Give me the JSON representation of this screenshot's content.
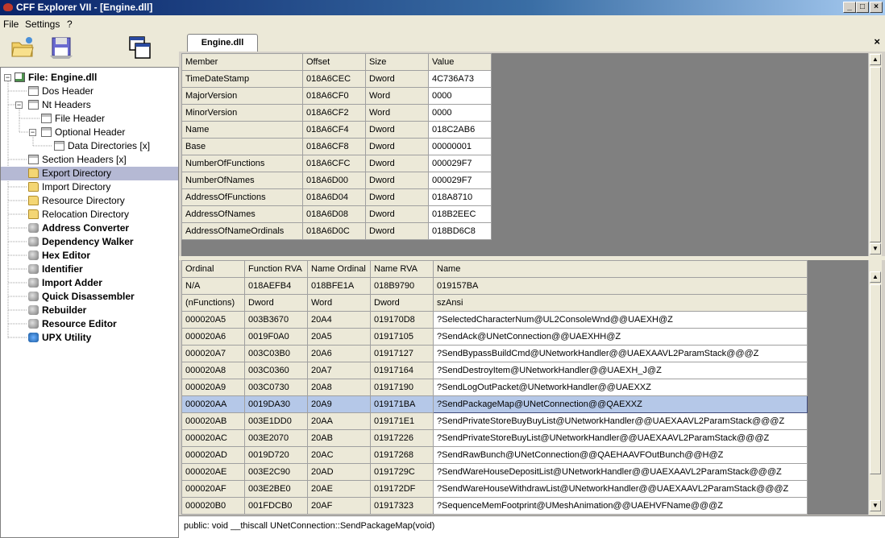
{
  "window": {
    "title": "CFF Explorer VII - [Engine.dll]",
    "minimize": "_",
    "maximize": "□",
    "close": "×"
  },
  "menu": [
    "File",
    "Settings",
    "?"
  ],
  "tree": {
    "root": "File: Engine.dll",
    "items": [
      "Dos Header",
      "Nt Headers",
      "File Header",
      "Optional Header",
      "Data Directories [x]",
      "Section Headers [x]",
      "Export Directory",
      "Import Directory",
      "Resource Directory",
      "Relocation Directory",
      "Address Converter",
      "Dependency Walker",
      "Hex Editor",
      "Identifier",
      "Import Adder",
      "Quick Disassembler",
      "Rebuilder",
      "Resource Editor",
      "UPX Utility"
    ]
  },
  "tab": {
    "label": "Engine.dll",
    "close": "×"
  },
  "export_table": {
    "headers": [
      "Member",
      "Offset",
      "Size",
      "Value"
    ],
    "rows": [
      [
        "TimeDateStamp",
        "018A6CEC",
        "Dword",
        "4C736A73"
      ],
      [
        "MajorVersion",
        "018A6CF0",
        "Word",
        "0000"
      ],
      [
        "MinorVersion",
        "018A6CF2",
        "Word",
        "0000"
      ],
      [
        "Name",
        "018A6CF4",
        "Dword",
        "018C2AB6"
      ],
      [
        "Base",
        "018A6CF8",
        "Dword",
        "00000001"
      ],
      [
        "NumberOfFunctions",
        "018A6CFC",
        "Dword",
        "000029F7"
      ],
      [
        "NumberOfNames",
        "018A6D00",
        "Dword",
        "000029F7"
      ],
      [
        "AddressOfFunctions",
        "018A6D04",
        "Dword",
        "018A8710"
      ],
      [
        "AddressOfNames",
        "018A6D08",
        "Dword",
        "018B2EEC"
      ],
      [
        "AddressOfNameOrdinals",
        "018A6D0C",
        "Dword",
        "018BD6C8"
      ]
    ]
  },
  "functions_table": {
    "headers": [
      "Ordinal",
      "Function RVA",
      "Name Ordinal",
      "Name RVA",
      "Name"
    ],
    "subrows": [
      [
        "N/A",
        "018AEFB4",
        "018BFE1A",
        "018B9790",
        "019157BA"
      ],
      [
        "(nFunctions)",
        "Dword",
        "Word",
        "Dword",
        "szAnsi"
      ]
    ],
    "rows": [
      [
        "000020A5",
        "003B3670",
        "20A4",
        "019170D8",
        "?SelectedCharacterNum@UL2ConsoleWnd@@UAEXH@Z"
      ],
      [
        "000020A6",
        "0019F0A0",
        "20A5",
        "01917105",
        "?SendAck@UNetConnection@@UAEXHH@Z"
      ],
      [
        "000020A7",
        "003C03B0",
        "20A6",
        "01917127",
        "?SendBypassBuildCmd@UNetworkHandler@@UAEXAAVL2ParamStack@@@Z"
      ],
      [
        "000020A8",
        "003C0360",
        "20A7",
        "01917164",
        "?SendDestroyItem@UNetworkHandler@@UAEXH_J@Z"
      ],
      [
        "000020A9",
        "003C0730",
        "20A8",
        "01917190",
        "?SendLogOutPacket@UNetworkHandler@@UAEXXZ"
      ],
      [
        "000020AA",
        "0019DA30",
        "20A9",
        "019171BA",
        "?SendPackageMap@UNetConnection@@QAEXXZ"
      ],
      [
        "000020AB",
        "003E1DD0",
        "20AA",
        "019171E1",
        "?SendPrivateStoreBuyBuyList@UNetworkHandler@@UAEXAAVL2ParamStack@@@Z"
      ],
      [
        "000020AC",
        "003E2070",
        "20AB",
        "01917226",
        "?SendPrivateStoreBuyList@UNetworkHandler@@UAEXAAVL2ParamStack@@@Z"
      ],
      [
        "000020AD",
        "0019D720",
        "20AC",
        "01917268",
        "?SendRawBunch@UNetConnection@@QAEHAAVFOutBunch@@H@Z"
      ],
      [
        "000020AE",
        "003E2C90",
        "20AD",
        "0191729C",
        "?SendWareHouseDepositList@UNetworkHandler@@UAEXAAVL2ParamStack@@@Z"
      ],
      [
        "000020AF",
        "003E2BE0",
        "20AE",
        "019172DF",
        "?SendWareHouseWithdrawList@UNetworkHandler@@UAEXAAVL2ParamStack@@@Z"
      ],
      [
        "000020B0",
        "001FDCB0",
        "20AF",
        "01917323",
        "?SequenceMemFootprint@UMeshAnimation@@UAEHVFName@@@Z"
      ]
    ],
    "selected_ordinal": "000020AA"
  },
  "status": "public: void __thiscall UNetConnection::SendPackageMap(void)"
}
